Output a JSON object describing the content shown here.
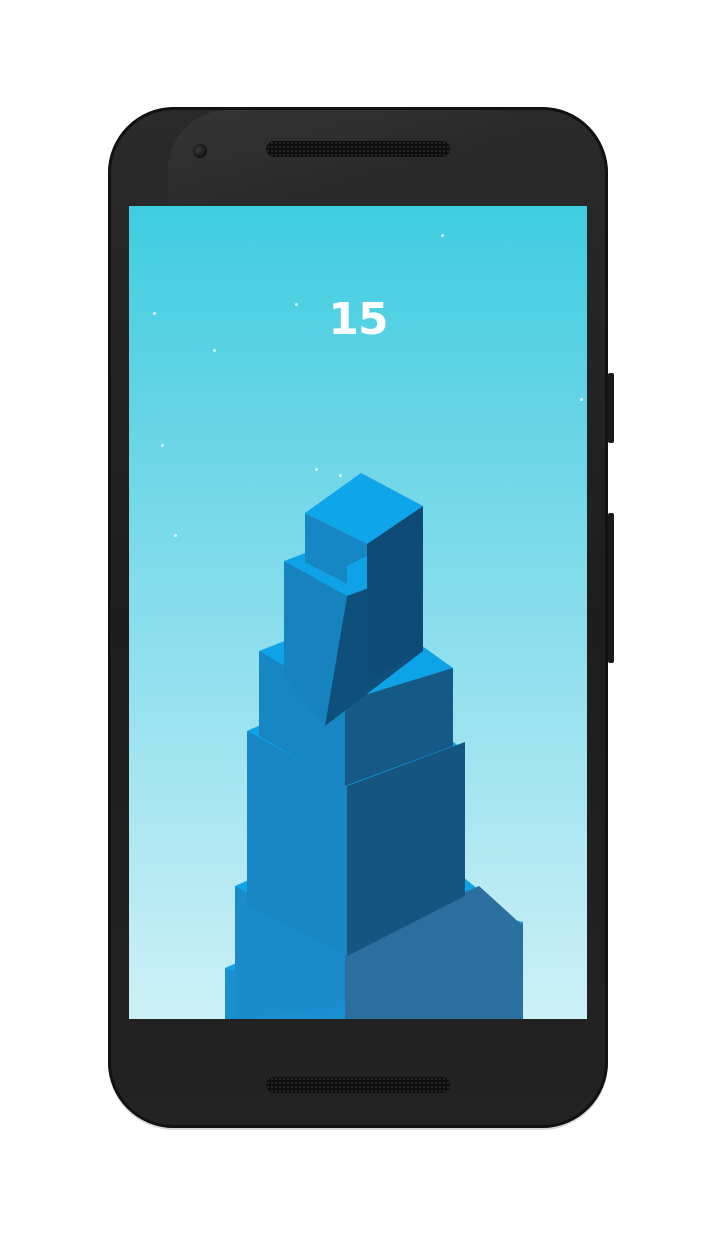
{
  "game": {
    "score": "15"
  },
  "colors": {
    "sky_top": "#3ecde1",
    "sky_bottom": "#cdf0f7",
    "block_top": "#0ea2e6",
    "block_left": "#1586c4",
    "block_right": "#0f4f7b"
  }
}
